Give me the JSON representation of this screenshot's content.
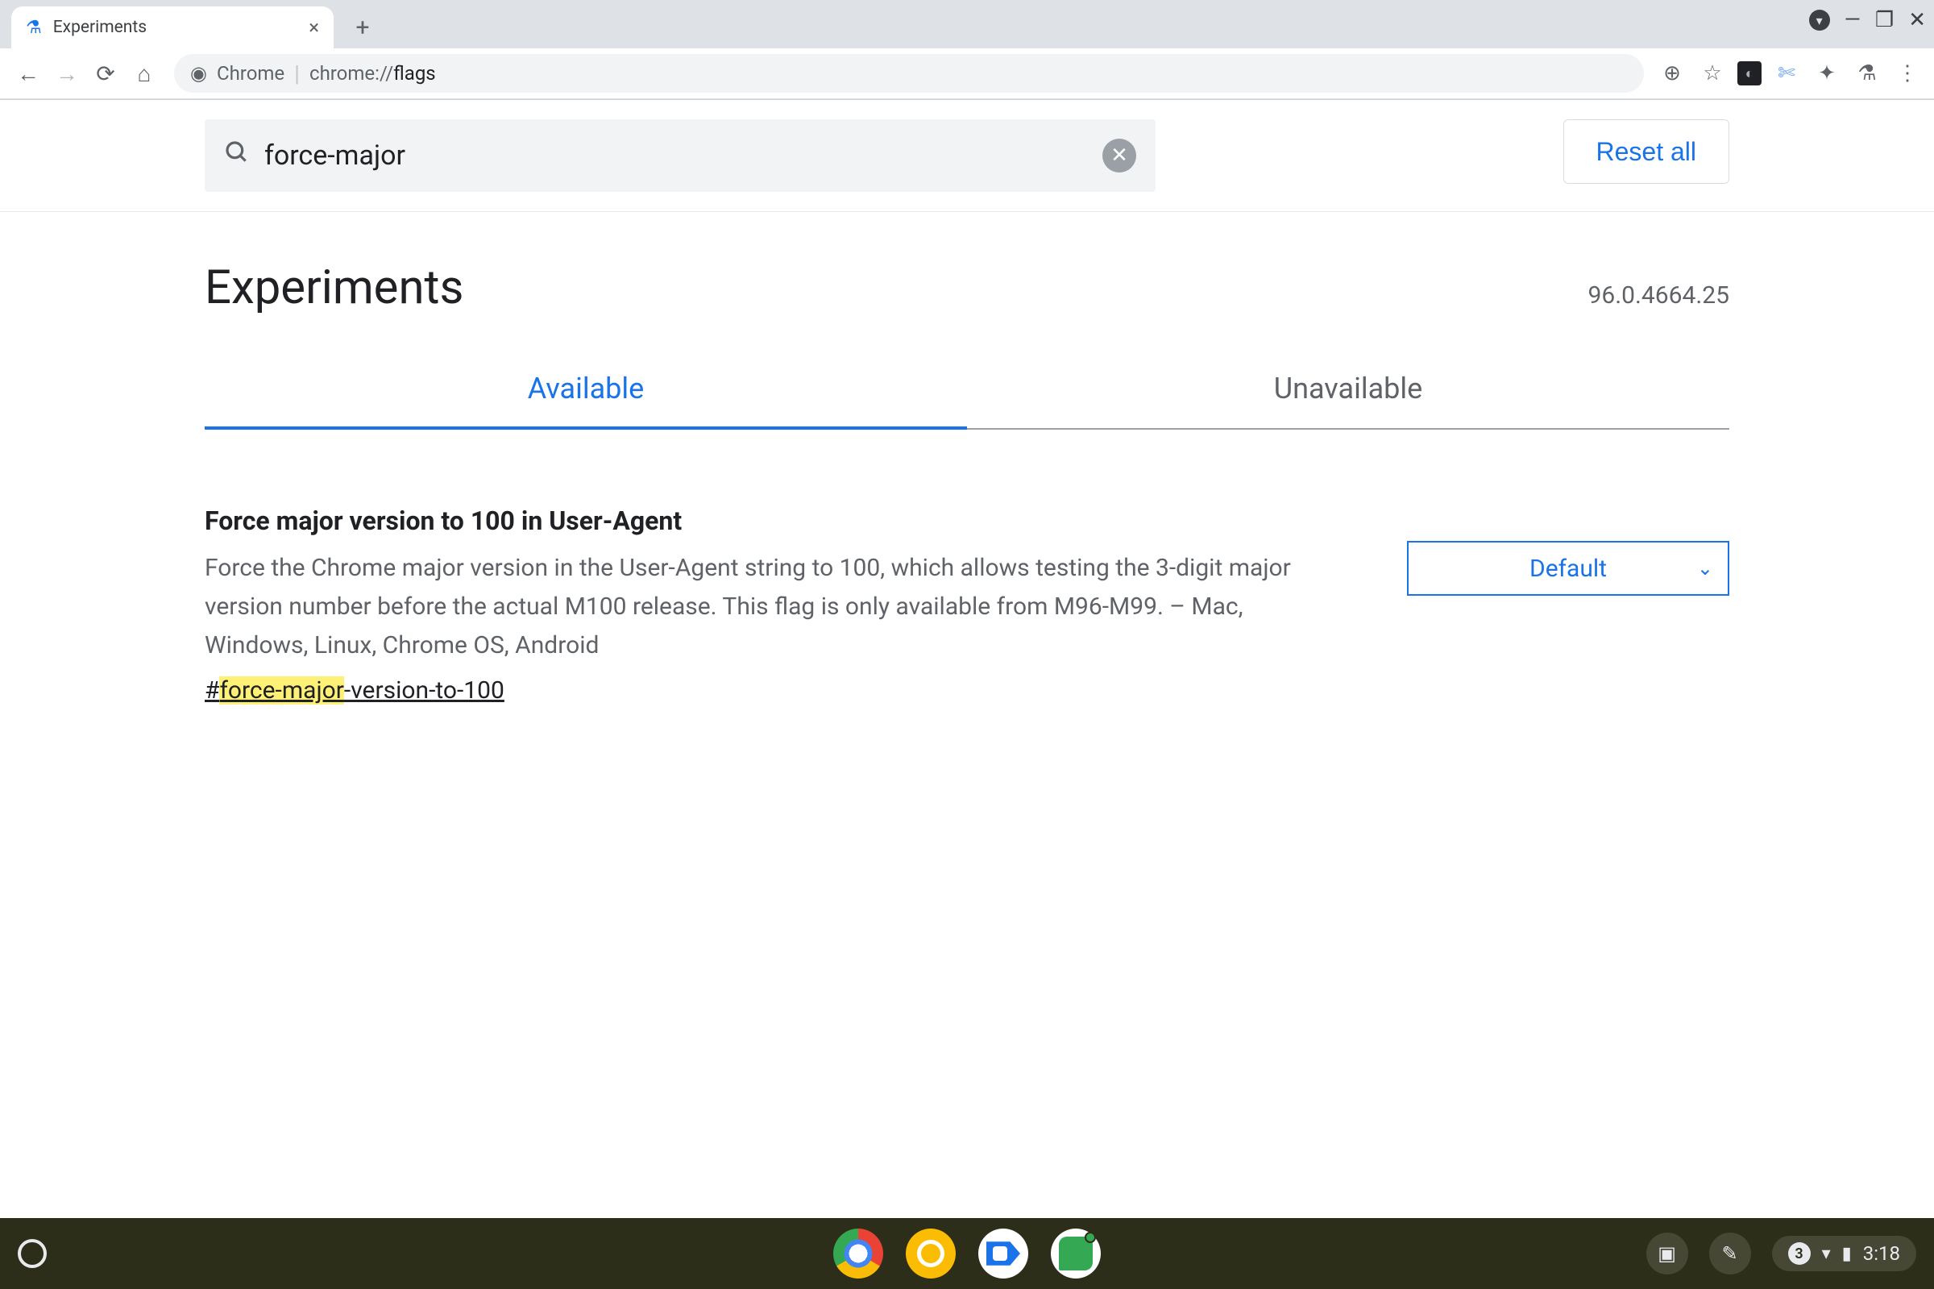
{
  "browser": {
    "tab_title": "Experiments",
    "url_label": "Chrome",
    "url_prefix": "chrome://",
    "url_path": "flags"
  },
  "search": {
    "value": "force-major"
  },
  "actions": {
    "reset": "Reset all"
  },
  "page_title": "Experiments",
  "version": "96.0.4664.25",
  "tabs": {
    "available": "Available",
    "unavailable": "Unavailable"
  },
  "flag": {
    "title": "Force major version to 100 in User-Agent",
    "description": "Force the Chrome major version in the User-Agent string to 100, which allows testing the 3-digit major version number before the actual M100 release. This flag is only available from M96-M99. – Mac, Windows, Linux, Chrome OS, Android",
    "anchor_prefix": "#",
    "anchor_hl": "force-major",
    "anchor_rest": "-version-to-100",
    "select_value": "Default"
  },
  "shelf": {
    "notifications": "3",
    "time": "3:18"
  }
}
